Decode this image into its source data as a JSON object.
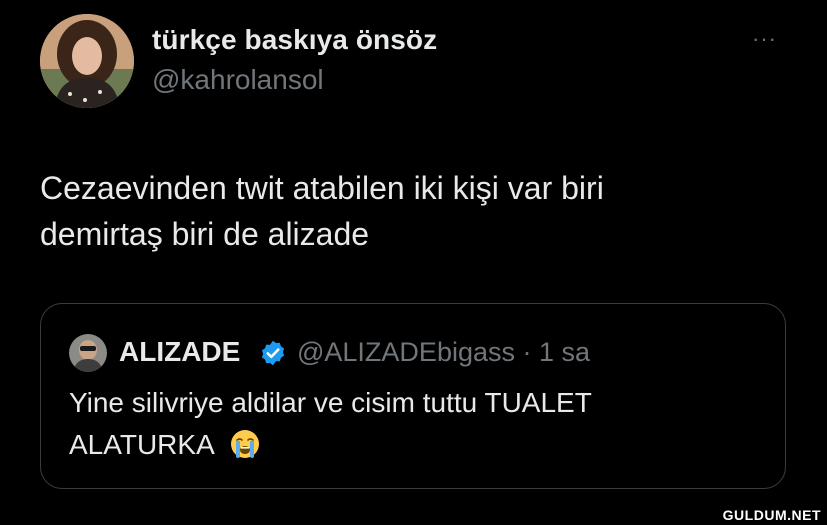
{
  "author": {
    "display_name": "türkçe baskıya önsöz",
    "handle": "@kahrolansol",
    "avatar_icon": "profile-photo"
  },
  "more_icon": "···",
  "tweet": {
    "text_line_1": "Cezaevinden twit atabilen iki kişi var biri",
    "text_line_2": "demirtaş biri de alizade"
  },
  "quoted_tweet": {
    "display_name": "ALIZADE",
    "verified": true,
    "handle": "@ALIZADEbigass",
    "separator": "·",
    "time": "1 sa",
    "text_line_1": "Yine silivriye aldilar ve cisim tuttu TUALET",
    "text_line_2": "ALATURKA",
    "emoji_icon": "loudly-crying-face"
  },
  "watermark": "GULDUM.NET",
  "colors": {
    "background": "#000000",
    "text": "#e7e9ea",
    "secondary": "#71767b",
    "border": "#3a3d40",
    "verified": "#1d9bf0"
  }
}
